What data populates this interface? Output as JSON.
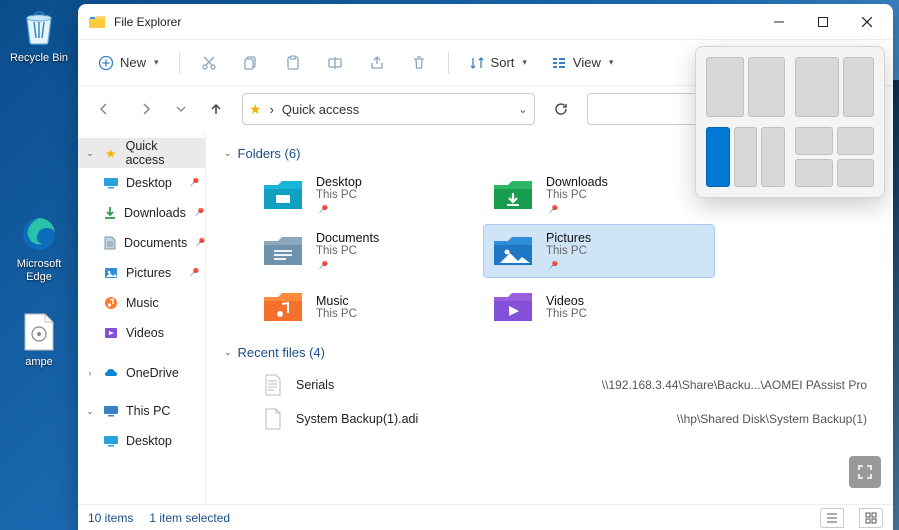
{
  "desktop": {
    "recycle_bin": "Recycle Bin",
    "edge": "Microsoft Edge",
    "ampe": "ampe"
  },
  "window": {
    "title": "File Explorer",
    "toolbar": {
      "new": "New",
      "sort": "Sort",
      "view": "View"
    },
    "address": {
      "path": "Quick access",
      "separator": "›"
    },
    "search_placeholder": "",
    "status": {
      "items": "10 items",
      "selected": "1 item selected"
    }
  },
  "sidebar": {
    "quick_access": "Quick access",
    "desktop": "Desktop",
    "downloads": "Downloads",
    "documents": "Documents",
    "pictures": "Pictures",
    "music": "Music",
    "videos": "Videos",
    "onedrive": "OneDrive",
    "this_pc": "This PC",
    "pc_desktop": "Desktop"
  },
  "sections": {
    "folders_header": "Folders (6)",
    "recent_header": "Recent files (4)"
  },
  "folders": {
    "desktop": {
      "name": "Desktop",
      "loc": "This PC"
    },
    "downloads": {
      "name": "Downloads",
      "loc": "This PC"
    },
    "documents": {
      "name": "Documents",
      "loc": "This PC"
    },
    "pictures": {
      "name": "Pictures",
      "loc": "This PC"
    },
    "music": {
      "name": "Music",
      "loc": "This PC"
    },
    "videos": {
      "name": "Videos",
      "loc": "This PC"
    }
  },
  "recent": {
    "r1": {
      "name": "Serials",
      "path": "\\\\192.168.3.44\\Share\\Backu...\\AOMEI PAssist Pro"
    },
    "r2": {
      "name": "System Backup(1).adi",
      "path": "\\\\hp\\Shared Disk\\System Backup(1)"
    }
  }
}
